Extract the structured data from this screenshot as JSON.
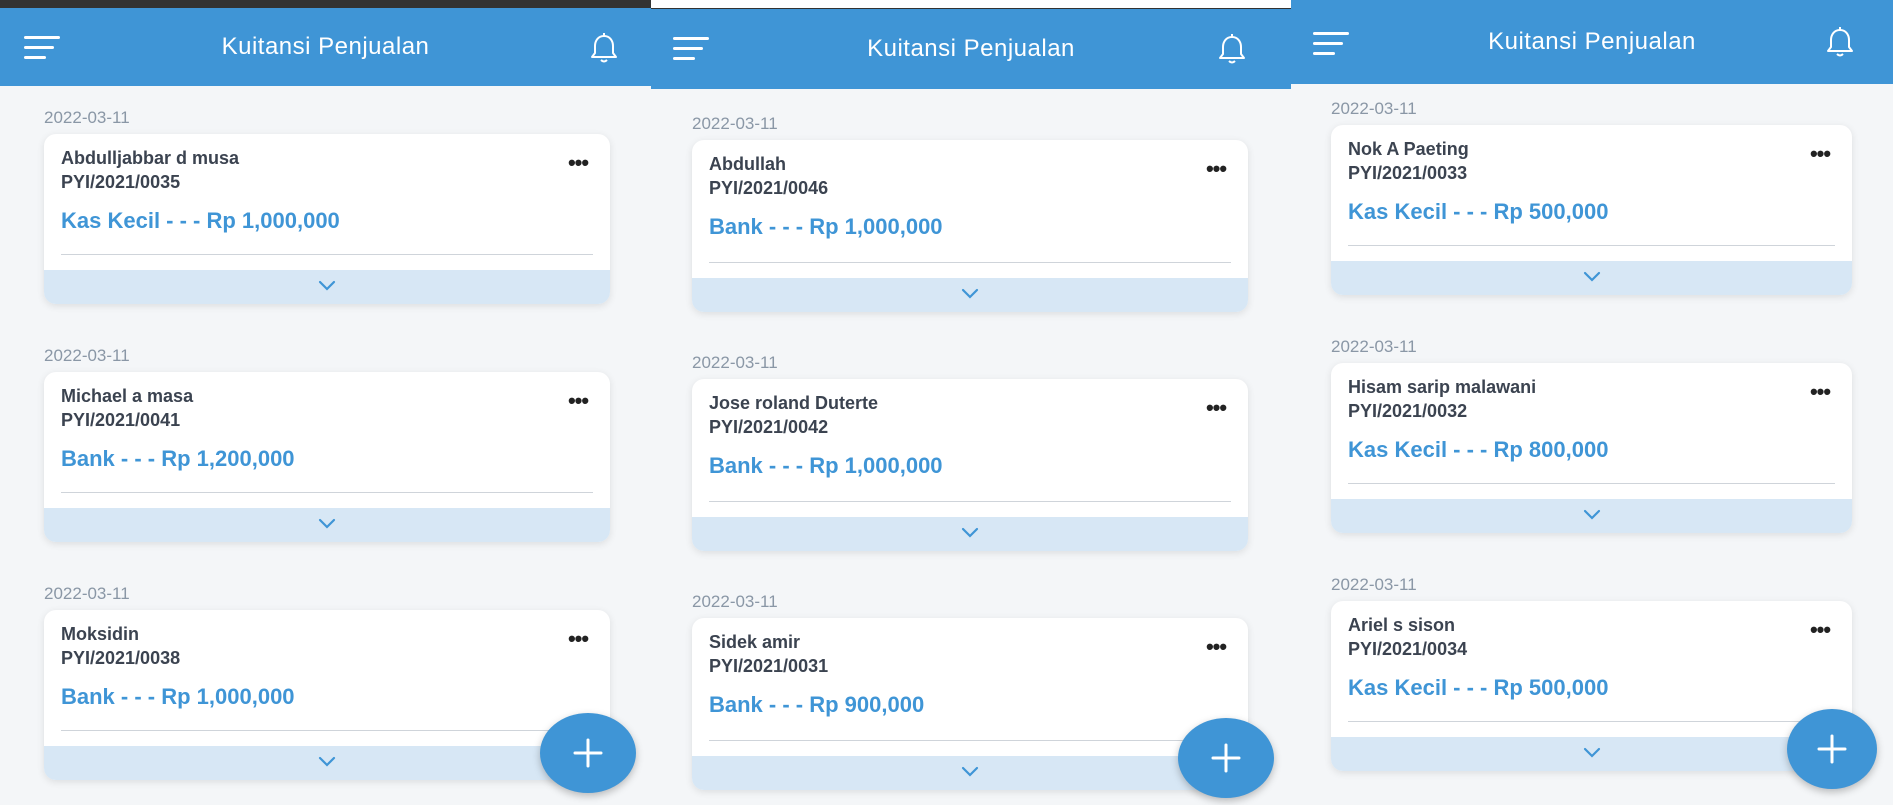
{
  "screens": [
    {
      "title": "Kuitansi Penjualan",
      "receipts": [
        {
          "date": "2022-03-11",
          "customer": "Abdulljabbar d musa",
          "doc_no": "PYI/2021/0035",
          "amount": "Kas Kecil - - - Rp 1,000,000"
        },
        {
          "date": "2022-03-11",
          "customer": "Michael a masa",
          "doc_no": "PYI/2021/0041",
          "amount": "Bank - - - Rp 1,200,000"
        },
        {
          "date": "2022-03-11",
          "customer": "Moksidin",
          "doc_no": "PYI/2021/0038",
          "amount": "Bank - - - Rp 1,000,000"
        }
      ]
    },
    {
      "title": "Kuitansi Penjualan",
      "receipts": [
        {
          "date": "2022-03-11",
          "customer": "Abdullah",
          "doc_no": "PYI/2021/0046",
          "amount": "Bank - - - Rp 1,000,000"
        },
        {
          "date": "2022-03-11",
          "customer": "Jose roland Duterte",
          "doc_no": "PYI/2021/0042",
          "amount": "Bank - - - Rp 1,000,000"
        },
        {
          "date": "2022-03-11",
          "customer": "Sidek amir",
          "doc_no": "PYI/2021/0031",
          "amount": "Bank - - - Rp 900,000"
        }
      ]
    },
    {
      "title": "Kuitansi Penjualan",
      "receipts": [
        {
          "date": "2022-03-11",
          "customer": "Nok A Paeting",
          "doc_no": "PYI/2021/0033",
          "amount": "Kas Kecil - - - Rp 500,000"
        },
        {
          "date": "2022-03-11",
          "customer": "Hisam sarip malawani",
          "doc_no": "PYI/2021/0032",
          "amount": "Kas Kecil - - - Rp 800,000"
        },
        {
          "date": "2022-03-11",
          "customer": "Ariel s sison",
          "doc_no": "PYI/2021/0034",
          "amount": "Kas Kecil - - - Rp 500,000"
        }
      ]
    }
  ],
  "icons": {
    "menu": "hamburger-menu-icon",
    "notifications": "bell-icon",
    "more": "more-options-icon",
    "expand": "chevron-down-icon",
    "add": "plus-icon"
  },
  "colors": {
    "header": "#3f95d6",
    "amount": "#3f95d6",
    "expand_bar": "#d7e7f5",
    "fab": "#3f95d6"
  }
}
